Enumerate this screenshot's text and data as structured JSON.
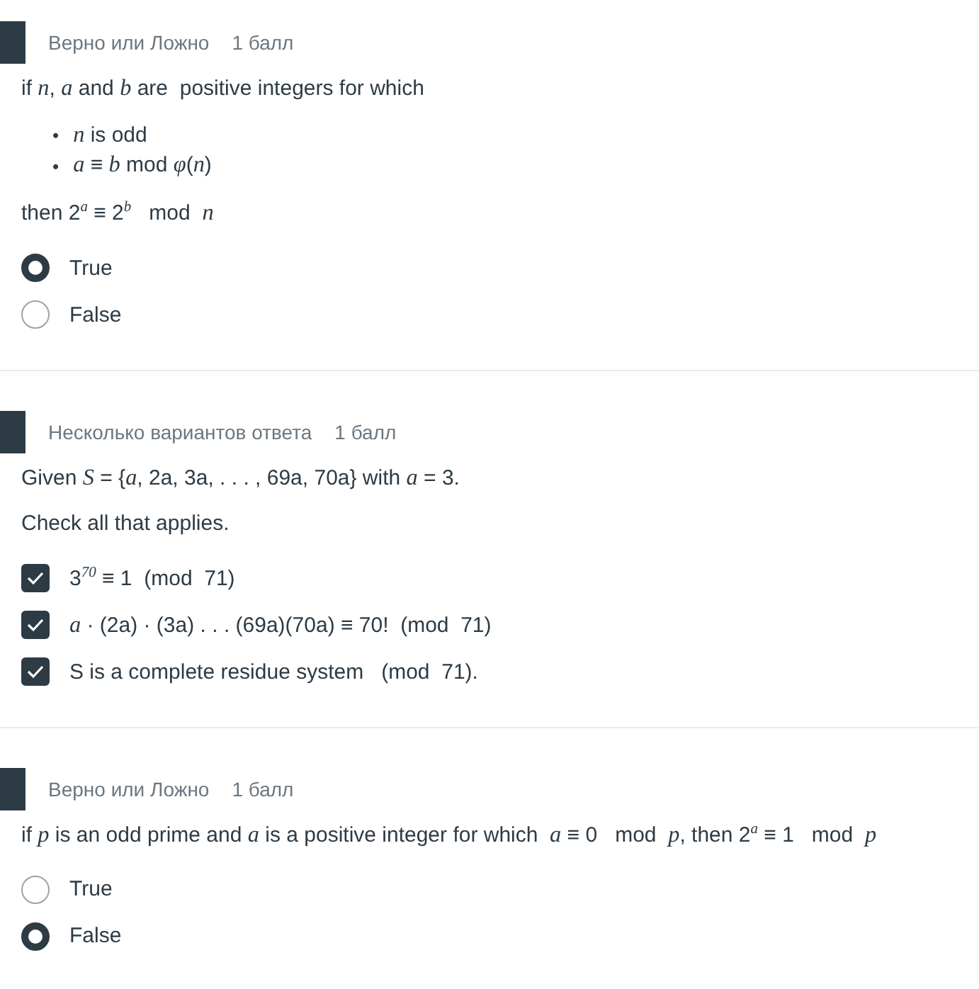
{
  "questions": [
    {
      "type_label": "Верно или Ложно",
      "points": "1 балл",
      "kind": "radio",
      "body": [
        {
          "kind": "paragraph",
          "text": "if *n*, *a* and *b* are  positive integers for which"
        },
        {
          "kind": "list",
          "items": [
            {
              "marker": "•",
              "text": "*n* is odd"
            },
            {
              "marker": "•",
              "text": "*a* ≡ *b* mod *φ*(*n*)"
            }
          ]
        },
        {
          "kind": "paragraph",
          "text": "then 2$^{a}$ ≡ 2$^{b}$   mod  *n*"
        }
      ],
      "options": [
        {
          "label": "True",
          "selected": true
        },
        {
          "label": "False",
          "selected": false
        }
      ]
    },
    {
      "type_label": "Несколько вариантов ответа",
      "points": "1 балл",
      "kind": "checkbox",
      "body": [
        {
          "kind": "paragraph",
          "text": "Given *S* = {*a*, 2a, 3a, . . . , 69a, 70a} with *a* = 3."
        },
        {
          "kind": "paragraph",
          "text": "Check all that applies."
        }
      ],
      "options": [
        {
          "label": "3$^{70}$ ≡ 1  (mod  71)",
          "selected": true
        },
        {
          "label": "*a* · (2a) · (3a) . . . (69a)(70a) ≡ 70!  (mod  71)",
          "selected": true
        },
        {
          "label": "S is a complete residue system   (mod  71).",
          "selected": true
        }
      ]
    },
    {
      "type_label": "Верно или Ложно",
      "points": "1 балл",
      "kind": "radio",
      "body": [
        {
          "kind": "paragraph",
          "text": "if *p* is an odd prime and *a* is a positive integer for which  *a* ≡ 0   mod  *p*, then 2$^{a}$ ≡ 1   mod  *p*"
        }
      ],
      "options": [
        {
          "label": "True",
          "selected": false
        },
        {
          "label": "False",
          "selected": true
        }
      ]
    }
  ]
}
